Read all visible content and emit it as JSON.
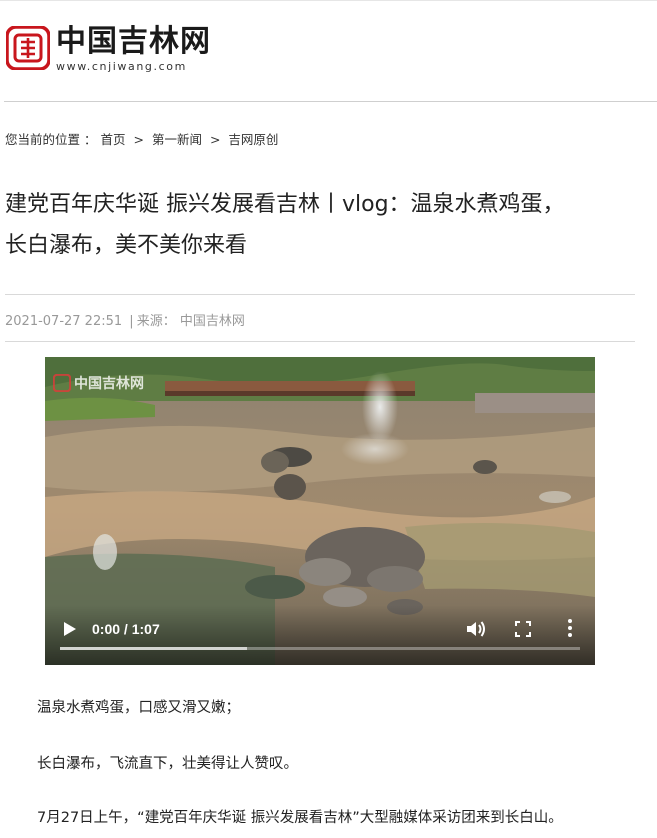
{
  "site": {
    "logo_cn": "中国吉林网",
    "logo_url": "www.cnjiwang.com",
    "brand_color": "#c8161d"
  },
  "breadcrumb": {
    "prefix": "您当前的位置 ：",
    "items": [
      "首页",
      "第一新闻",
      "吉网原创"
    ],
    "separator": ">"
  },
  "article": {
    "title_line1": "建党百年庆华诞 振兴发展看吉林丨vlog：温泉水煮鸡蛋，",
    "title_line2": "长白瀑布，美不美你来看",
    "datetime": "2021-07-27 22:51",
    "meta_separator": "|",
    "source_label": "来源：",
    "source": "中国吉林网",
    "paragraphs": [
      "温泉水煮鸡蛋，口感又滑又嫩；",
      "长白瀑布，飞流直下，壮美得让人赞叹。",
      "7月27日上午，“建党百年庆华诞 振兴发展看吉林”大型融媒体采访团来到长白山。"
    ]
  },
  "video": {
    "watermark": "中国吉林网",
    "current_time": "0:00",
    "time_separator": "/",
    "duration": "1:07",
    "progress_fraction": 0.0,
    "buffered_fraction": 0.36,
    "icons": [
      "play-icon",
      "volume-icon",
      "fullscreen-icon",
      "more-options-icon"
    ]
  }
}
